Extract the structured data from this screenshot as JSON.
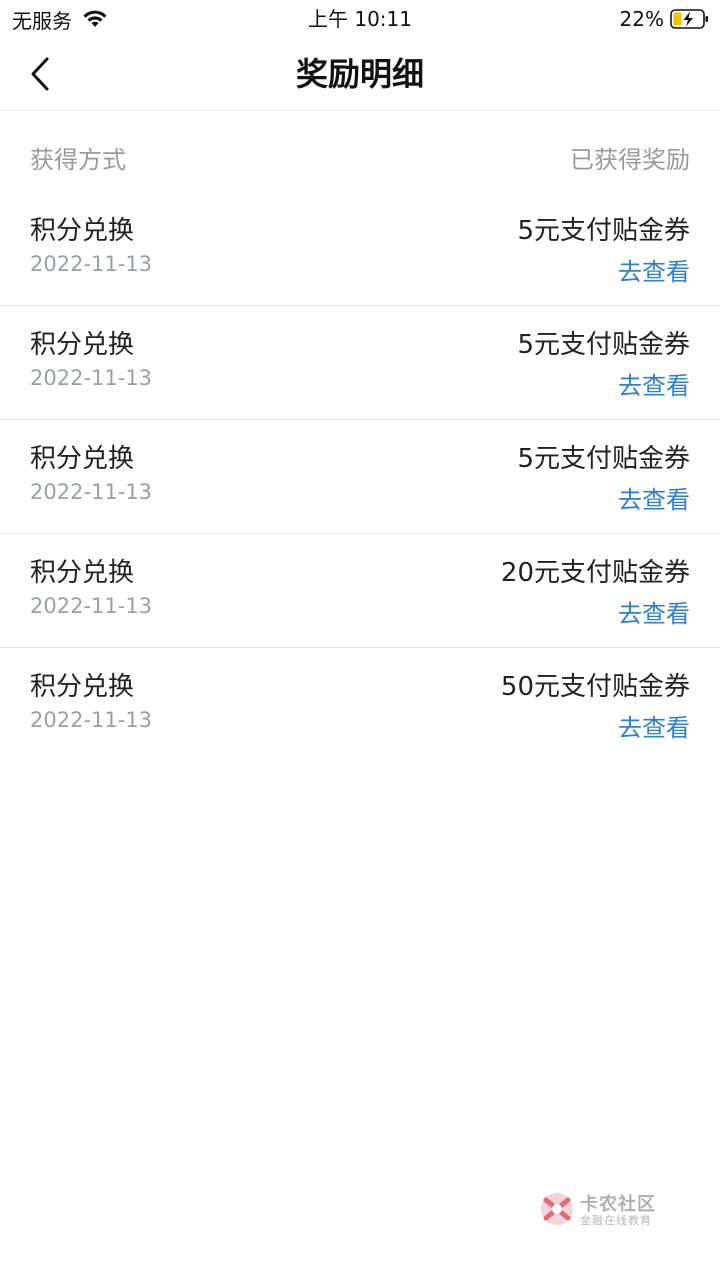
{
  "status_bar": {
    "carrier": "无服务",
    "time": "上午 10:11",
    "battery": "22%"
  },
  "header": {
    "title": "奖励明细",
    "back_icon": "chevron-left-icon"
  },
  "columns": {
    "method": "获得方式",
    "reward": "已获得奖励"
  },
  "rows": [
    {
      "method": "积分兑换",
      "date": "2022-11-13",
      "reward": "5元支付贴金券",
      "link": "去查看"
    },
    {
      "method": "积分兑换",
      "date": "2022-11-13",
      "reward": "5元支付贴金券",
      "link": "去查看"
    },
    {
      "method": "积分兑换",
      "date": "2022-11-13",
      "reward": "5元支付贴金券",
      "link": "去查看"
    },
    {
      "method": "积分兑换",
      "date": "2022-11-13",
      "reward": "20元支付贴金券",
      "link": "去查看"
    },
    {
      "method": "积分兑换",
      "date": "2022-11-13",
      "reward": "50元支付贴金券",
      "link": "去查看"
    }
  ],
  "watermark": {
    "title": "卡农社区",
    "subtitle": "金融在线教育"
  },
  "colors": {
    "link": "#2d7fd1",
    "muted": "#9a9a9a",
    "text": "#222222"
  }
}
